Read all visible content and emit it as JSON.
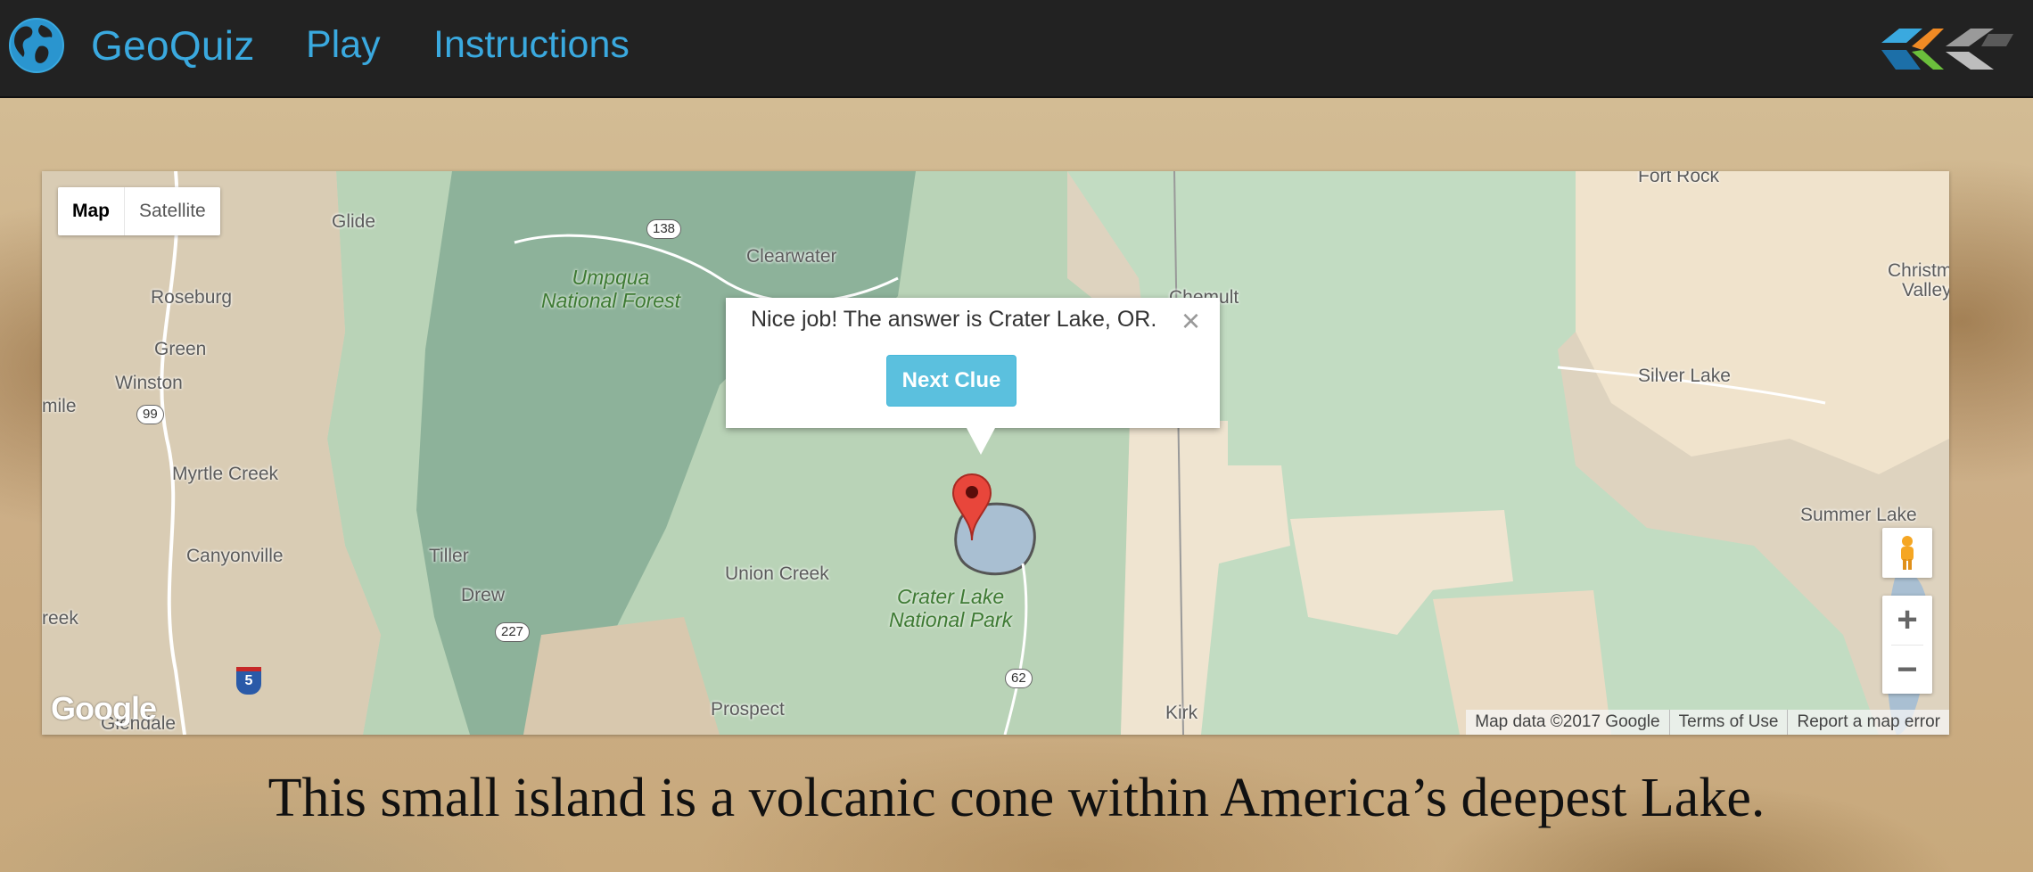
{
  "navbar": {
    "brand": "GeoQuiz",
    "brand_icon": "globe-icon",
    "links": [
      {
        "label": "Play"
      },
      {
        "label": "Instructions"
      }
    ],
    "corner_logo_icon": "brand-logo-icon",
    "link_color": "#3aa9df",
    "background": "#222222"
  },
  "map": {
    "type_control": {
      "options": [
        "Map",
        "Satellite"
      ],
      "selected": "Map"
    },
    "labels": {
      "glide": "Glide",
      "roseburg": "Roseburg",
      "green": "Green",
      "winston": "Winston",
      "mile": "mile",
      "myrtle_creek": "Myrtle Creek",
      "canyonville": "Canyonville",
      "tiller": "Tiller",
      "drew": "Drew",
      "reek": "reek",
      "glendale": "Glendale",
      "clearwater": "Clearwater",
      "chemult": "Chemult",
      "union_creek": "Union Creek",
      "prospect": "Prospect",
      "kirk": "Kirk",
      "fort_rock": "Fort Rock",
      "silver_lake": "Silver Lake",
      "summer_lake": "Summer Lake",
      "christmas_valley_1": "Christm",
      "christmas_valley_2": "Valley"
    },
    "parks": {
      "umpqua_1": "Umpqua",
      "umpqua_2": "National Forest",
      "crater_1": "Crater Lake",
      "crater_2": "National Park"
    },
    "routes": {
      "r138": "138",
      "r99": "99",
      "r227": "227",
      "r62": "62",
      "i5": "5"
    },
    "google_logo": "Google",
    "attribution": [
      "Map data ©2017 Google",
      "Terms of Use",
      "Report a map error"
    ],
    "zoom_in": "+",
    "zoom_out": "−"
  },
  "infowindow": {
    "message": "Nice job! The answer is Crater Lake, OR.",
    "close": "×",
    "button": "Next Clue",
    "button_color": "#5bc0de"
  },
  "clue": "This small island is a volcanic cone within America’s deepest Lake."
}
